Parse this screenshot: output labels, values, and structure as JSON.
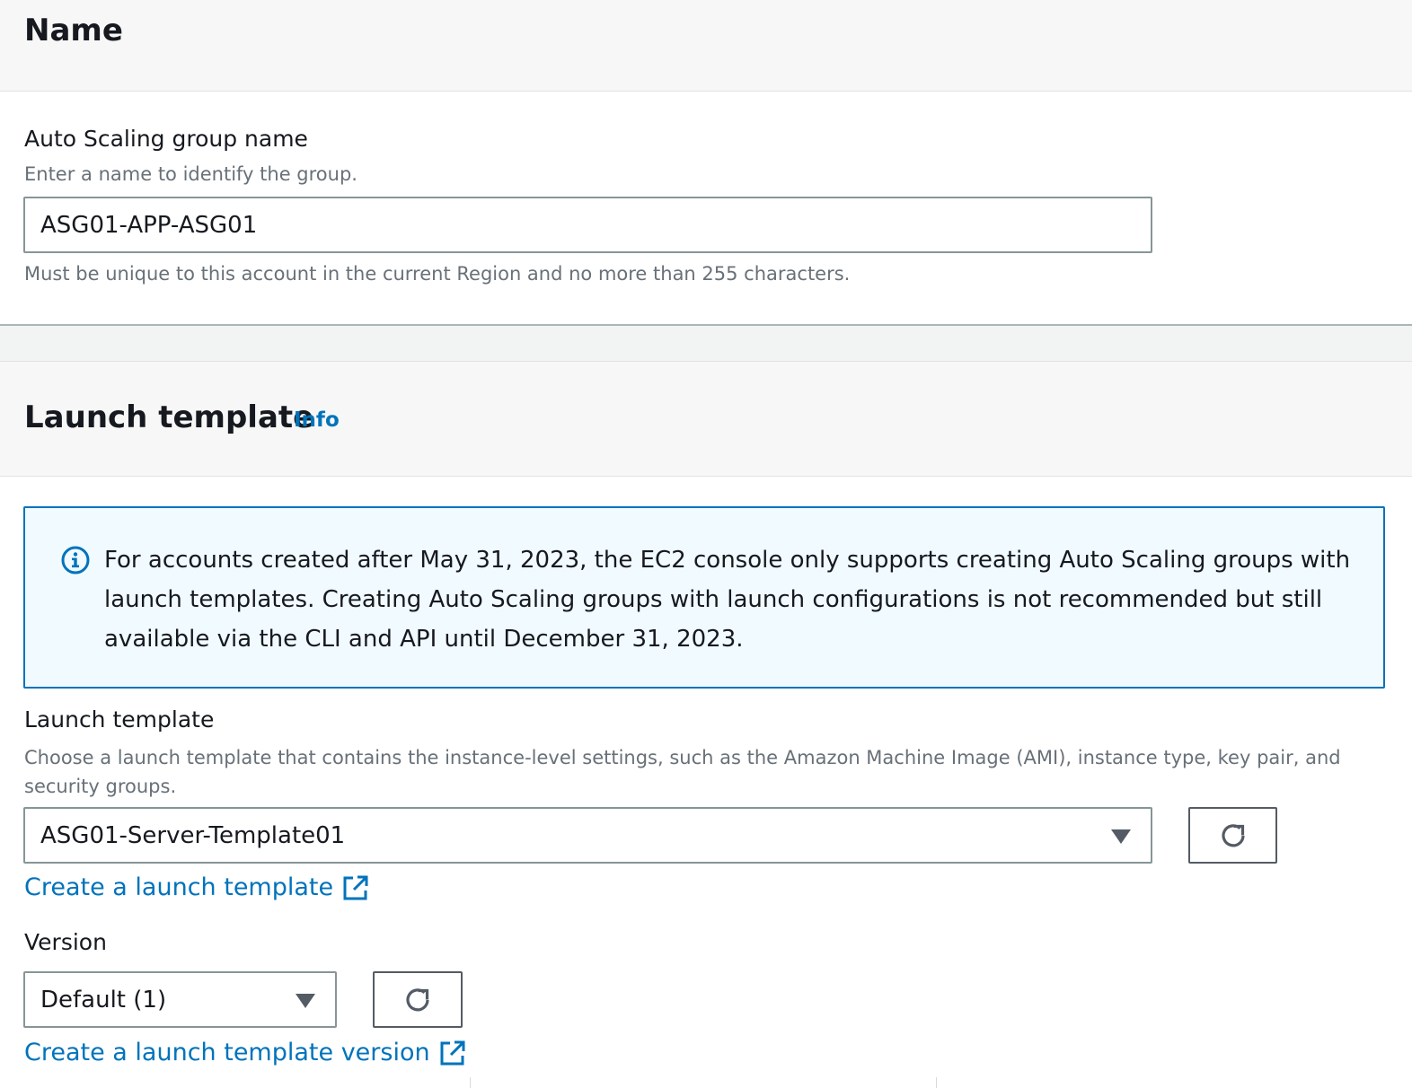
{
  "name_section": {
    "title": "Name",
    "field_label": "Auto Scaling group name",
    "field_description": "Enter a name to identify the group.",
    "field_value": "ASG01-APP-ASG01",
    "field_constraint": "Must be unique to this account in the current Region and no more than 255 characters."
  },
  "launch_template_section": {
    "title": "Launch template",
    "info_link": "Info",
    "alert": {
      "icon": "info-circle-icon",
      "text": "For accounts created after May 31, 2023, the EC2 console only supports creating Auto Scaling groups with launch templates. Creating Auto Scaling groups with launch configurations is not recommended but still available via the CLI and API until December 31, 2023."
    },
    "template_field": {
      "label": "Launch template",
      "description": "Choose a launch template that contains the instance-level settings, such as the Amazon Machine Image (AMI), instance type, key pair, and security groups.",
      "selected": "ASG01-Server-Template01",
      "create_link": "Create a launch template"
    },
    "version_field": {
      "label": "Version",
      "selected": "Default (1)",
      "create_link": "Create a launch template version"
    }
  },
  "colors": {
    "link": "#0073bb",
    "alert_border": "#0073bb",
    "alert_background": "#f1faff",
    "header_background": "#f7f7f7",
    "text": "#16191f",
    "muted_text": "#687078"
  }
}
